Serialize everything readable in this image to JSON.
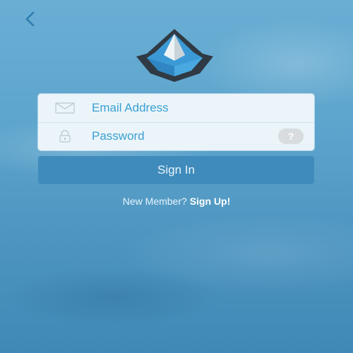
{
  "colors": {
    "accent": "#3ba0d3",
    "button": "#3f8bbb",
    "help_badge": "#d9dcde",
    "logo_blue": "#3b9ad6",
    "logo_dark": "#2f3a44"
  },
  "icons": {
    "back": "chevron-left-icon",
    "logo": "pyramid-logo",
    "email": "envelope-icon",
    "password": "lock-icon",
    "help": "question-mark"
  },
  "login": {
    "email_placeholder": "Email Address",
    "password_placeholder": "Password",
    "help_label": "?",
    "sign_in_label": "Sign In"
  },
  "signup": {
    "prompt": "New Member?",
    "link_label": "Sign Up!"
  }
}
